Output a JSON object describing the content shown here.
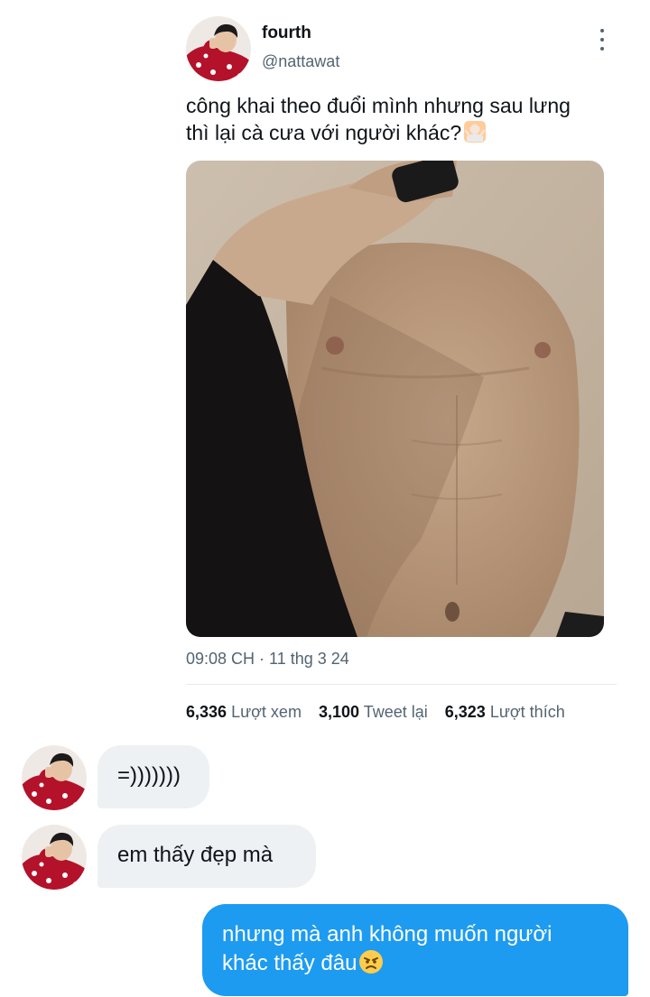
{
  "tweet": {
    "display_name": "fourth",
    "handle": "@nattawat",
    "text_line1": "công khai theo đuổi mình nhưng sau lưng",
    "text_line2": "thì lại cà cưa với người khác?",
    "emoji": "person-shrugging-emoji",
    "media": "photo-shirtless-mirror-selfie",
    "time": "09:08 CH",
    "separator": " · ",
    "date": "11 thg 3 24",
    "stats": [
      {
        "number": "6,336",
        "label": "Lượt xem"
      },
      {
        "number": "3,100",
        "label": "Tweet lại"
      },
      {
        "number": "6,323",
        "label": "Lượt thích"
      }
    ]
  },
  "chat": {
    "messages": [
      {
        "direction": "incoming",
        "text": "=)))))))"
      },
      {
        "direction": "incoming",
        "text": "em thấy đẹp mà"
      },
      {
        "direction": "outgoing",
        "text_line1": "nhưng mà anh không muốn người",
        "text_line2": "khác thấy đâu",
        "emoji": "angry-face-emoji"
      }
    ]
  },
  "colors": {
    "outgoing_bubble": "#1d9bf0",
    "incoming_bubble": "#eef1f4",
    "secondary_text": "#536471",
    "avatar_shirt": "#b3122a"
  }
}
